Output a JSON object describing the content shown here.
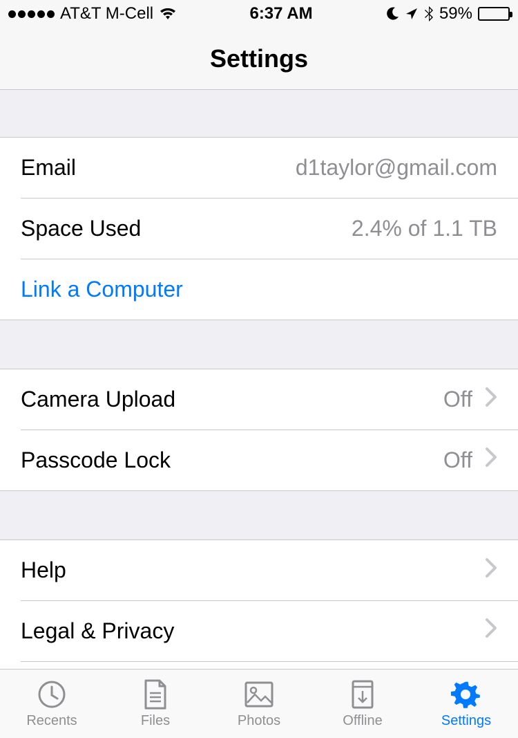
{
  "status_bar": {
    "carrier": "AT&T M-Cell",
    "time": "6:37 AM",
    "battery_percent": "59%",
    "battery_fill_percent": 59
  },
  "header": {
    "title": "Settings"
  },
  "account": {
    "email_label": "Email",
    "email_value": "d1taylor@gmail.com",
    "space_label": "Space Used",
    "space_value": "2.4% of 1.1 TB",
    "link_computer_label": "Link a Computer"
  },
  "options": {
    "camera_upload_label": "Camera Upload",
    "camera_upload_value": "Off",
    "passcode_label": "Passcode Lock",
    "passcode_value": "Off"
  },
  "support": {
    "help_label": "Help",
    "legal_label": "Legal & Privacy"
  },
  "tabs": {
    "recents": "Recents",
    "files": "Files",
    "photos": "Photos",
    "offline": "Offline",
    "settings": "Settings"
  }
}
